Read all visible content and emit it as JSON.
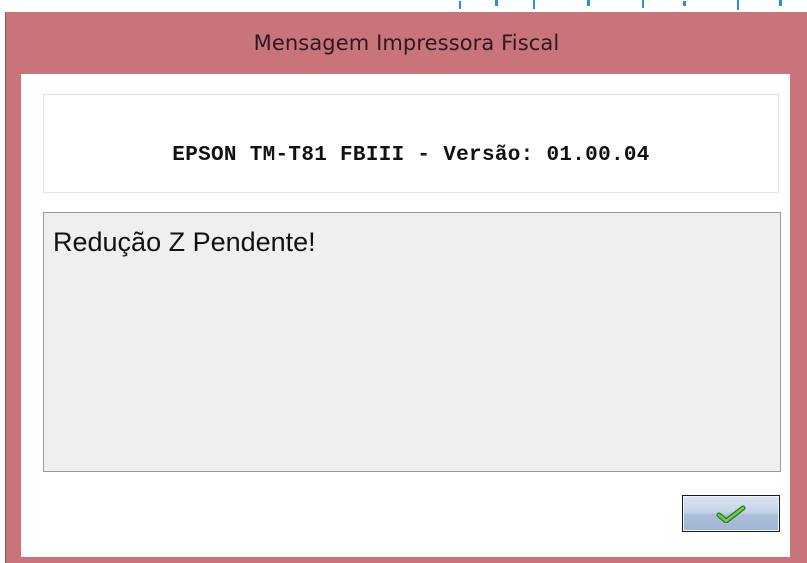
{
  "window": {
    "title": "Mensagem Impressora Fiscal"
  },
  "printer": {
    "version_line": "EPSON TM-T81 FBIII - Versão: 01.00.04"
  },
  "message": {
    "text": "Redução Z Pendente!"
  },
  "buttons": {
    "ok_icon": "check-icon"
  },
  "colors": {
    "titlebar": "#c9737b",
    "message_bg": "#efefef",
    "accent": "#2a8fd8",
    "check_green": "#4caf2d"
  }
}
